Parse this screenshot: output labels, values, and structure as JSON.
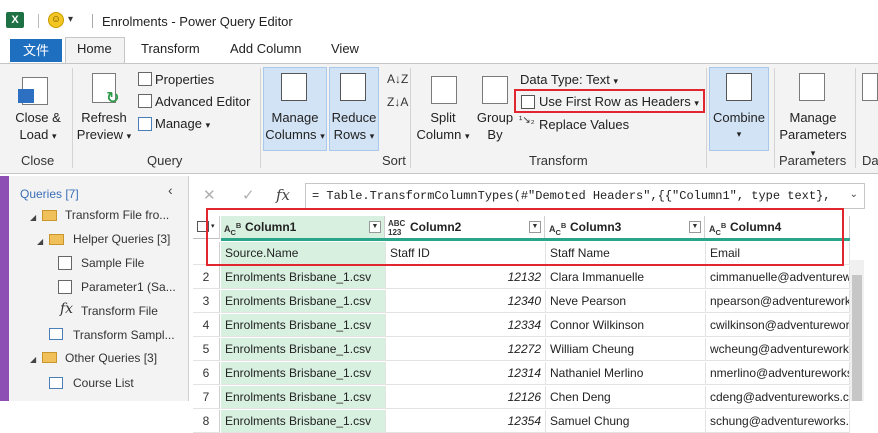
{
  "window": {
    "title": "Enrolments - Power Query Editor",
    "app_icon": "excel-icon",
    "qat_icon": "smiley-icon"
  },
  "tabs": {
    "file": "文件",
    "home": "Home",
    "transform": "Transform",
    "add_column": "Add Column",
    "view": "View"
  },
  "ribbon": {
    "close_load": "Close &",
    "close_load2": "Load",
    "close_group": "Close",
    "refresh": "Refresh",
    "refresh2": "Preview",
    "properties": "Properties",
    "advanced_editor": "Advanced Editor",
    "manage": "Manage",
    "query_group": "Query",
    "manage_columns": "Manage",
    "manage_columns2": "Columns",
    "reduce_rows": "Reduce",
    "reduce_rows2": "Rows",
    "sort_group": "Sort",
    "split_column": "Split",
    "split_column2": "Column",
    "group_by": "Group",
    "group_by2": "By",
    "data_type": "Data Type: Text",
    "use_first_row": "Use First Row as Headers",
    "replace_values": "Replace Values",
    "transform_group": "Transform",
    "combine": "Combine",
    "manage_parameters": "Manage",
    "manage_parameters2": "Parameters",
    "parameters_group": "Parameters",
    "cut_group": "Da"
  },
  "queries": {
    "header": "Queries [7]",
    "items": [
      {
        "label": "Transform File fro..."
      },
      {
        "label": "Helper Queries [3]"
      },
      {
        "label": "Sample File"
      },
      {
        "label": "Parameter1 (Sa..."
      },
      {
        "label": "Transform File"
      },
      {
        "label": "Transform Sampl..."
      },
      {
        "label": "Other Queries [3]"
      },
      {
        "label": "Course List"
      }
    ]
  },
  "formula": {
    "text": "= Table.TransformColumnTypes(#\"Demoted Headers\",{{\"Column1\", type text},",
    "cancel": "✕",
    "confirm": "✓",
    "fx": "fx"
  },
  "table": {
    "columns": [
      {
        "type_top": "A",
        "type_bottom": "C",
        "type_mid": "B",
        "name": "Column1"
      },
      {
        "type_top": "ABC",
        "type_bottom": "123",
        "type_mid": "",
        "name": "Column2"
      },
      {
        "type_top": "A",
        "type_bottom": "C",
        "type_mid": "B",
        "name": "Column3"
      },
      {
        "type_top": "A",
        "type_bottom": "C",
        "type_mid": "B",
        "name": "Column4"
      }
    ],
    "rows": [
      {
        "n": "",
        "c1": "Source.Name",
        "c2": "Staff ID",
        "c3": "Staff Name",
        "c4": "Email"
      },
      {
        "n": "2",
        "c1": "Enrolments Brisbane_1.csv",
        "c2": "12132",
        "c3": "Clara Immanuelle",
        "c4": "cimmanuelle@adventureworks.com"
      },
      {
        "n": "3",
        "c1": "Enrolments Brisbane_1.csv",
        "c2": "12340",
        "c3": "Neve Pearson",
        "c4": "npearson@adventureworks.com"
      },
      {
        "n": "4",
        "c1": "Enrolments Brisbane_1.csv",
        "c2": "12334",
        "c3": "Connor Wilkinson",
        "c4": "cwilkinson@adventureworks.com"
      },
      {
        "n": "5",
        "c1": "Enrolments Brisbane_1.csv",
        "c2": "12272",
        "c3": "William Cheung",
        "c4": "wcheung@adventureworks.com"
      },
      {
        "n": "6",
        "c1": "Enrolments Brisbane_1.csv",
        "c2": "12314",
        "c3": "Nathaniel Merlino",
        "c4": "nmerlino@adventureworks.com"
      },
      {
        "n": "7",
        "c1": "Enrolments Brisbane_1.csv",
        "c2": "12126",
        "c3": "Chen Deng",
        "c4": "cdeng@adventureworks.com"
      },
      {
        "n": "8",
        "c1": "Enrolments Brisbane_1.csv",
        "c2": "12354",
        "c3": "Samuel Chung",
        "c4": "schung@adventureworks.com"
      }
    ]
  },
  "colors": {
    "accent": "#1f6fc1",
    "highlight_red": "#e1262f",
    "selected_col": "#d8f0e0",
    "teal_bar": "#2aa58a"
  }
}
